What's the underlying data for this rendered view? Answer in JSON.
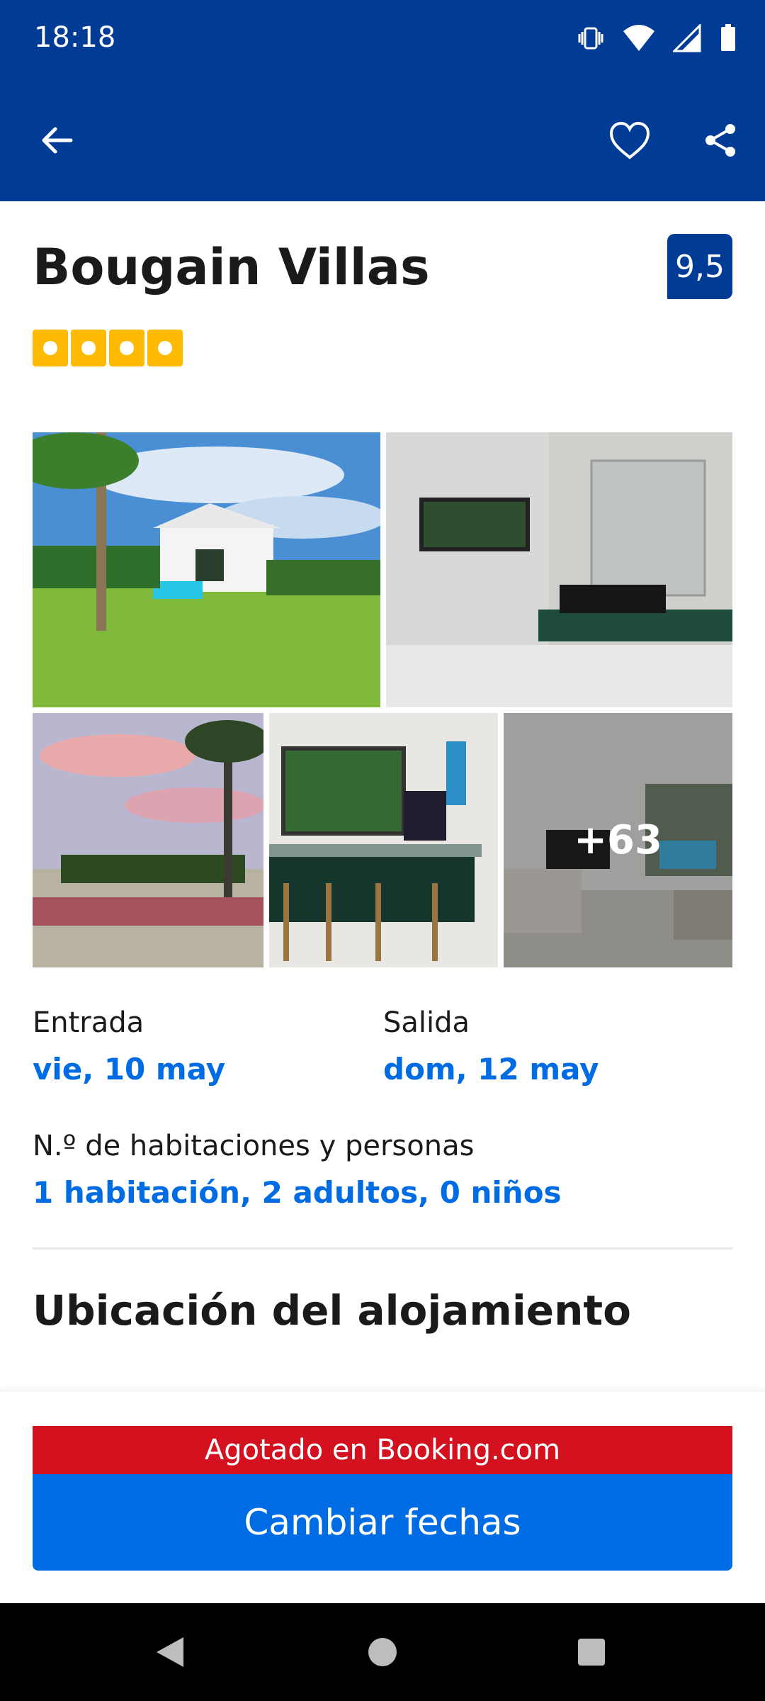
{
  "status_bar": {
    "time": "18:18"
  },
  "hotel": {
    "name": "Bougain Villas",
    "score": "9,5",
    "star_count": 4
  },
  "photos": {
    "more_count": "+63"
  },
  "dates": {
    "checkin_label": "Entrada",
    "checkin_value": "vie, 10 may",
    "checkout_label": "Salida",
    "checkout_value": "dom, 12 may"
  },
  "guests": {
    "label": "N.º de habitaciones y personas",
    "value": "1 habitación, 2 adultos, 0 niños"
  },
  "location": {
    "title": "Ubicación del alojamiento"
  },
  "footer": {
    "sold_out": "Agotado en Booking.com",
    "change_dates": "Cambiar fechas"
  },
  "colors": {
    "brand_blue": "#003b95",
    "action_blue": "#006ce4",
    "sold_out_red": "#d4111e",
    "star_yellow": "#febb02"
  }
}
